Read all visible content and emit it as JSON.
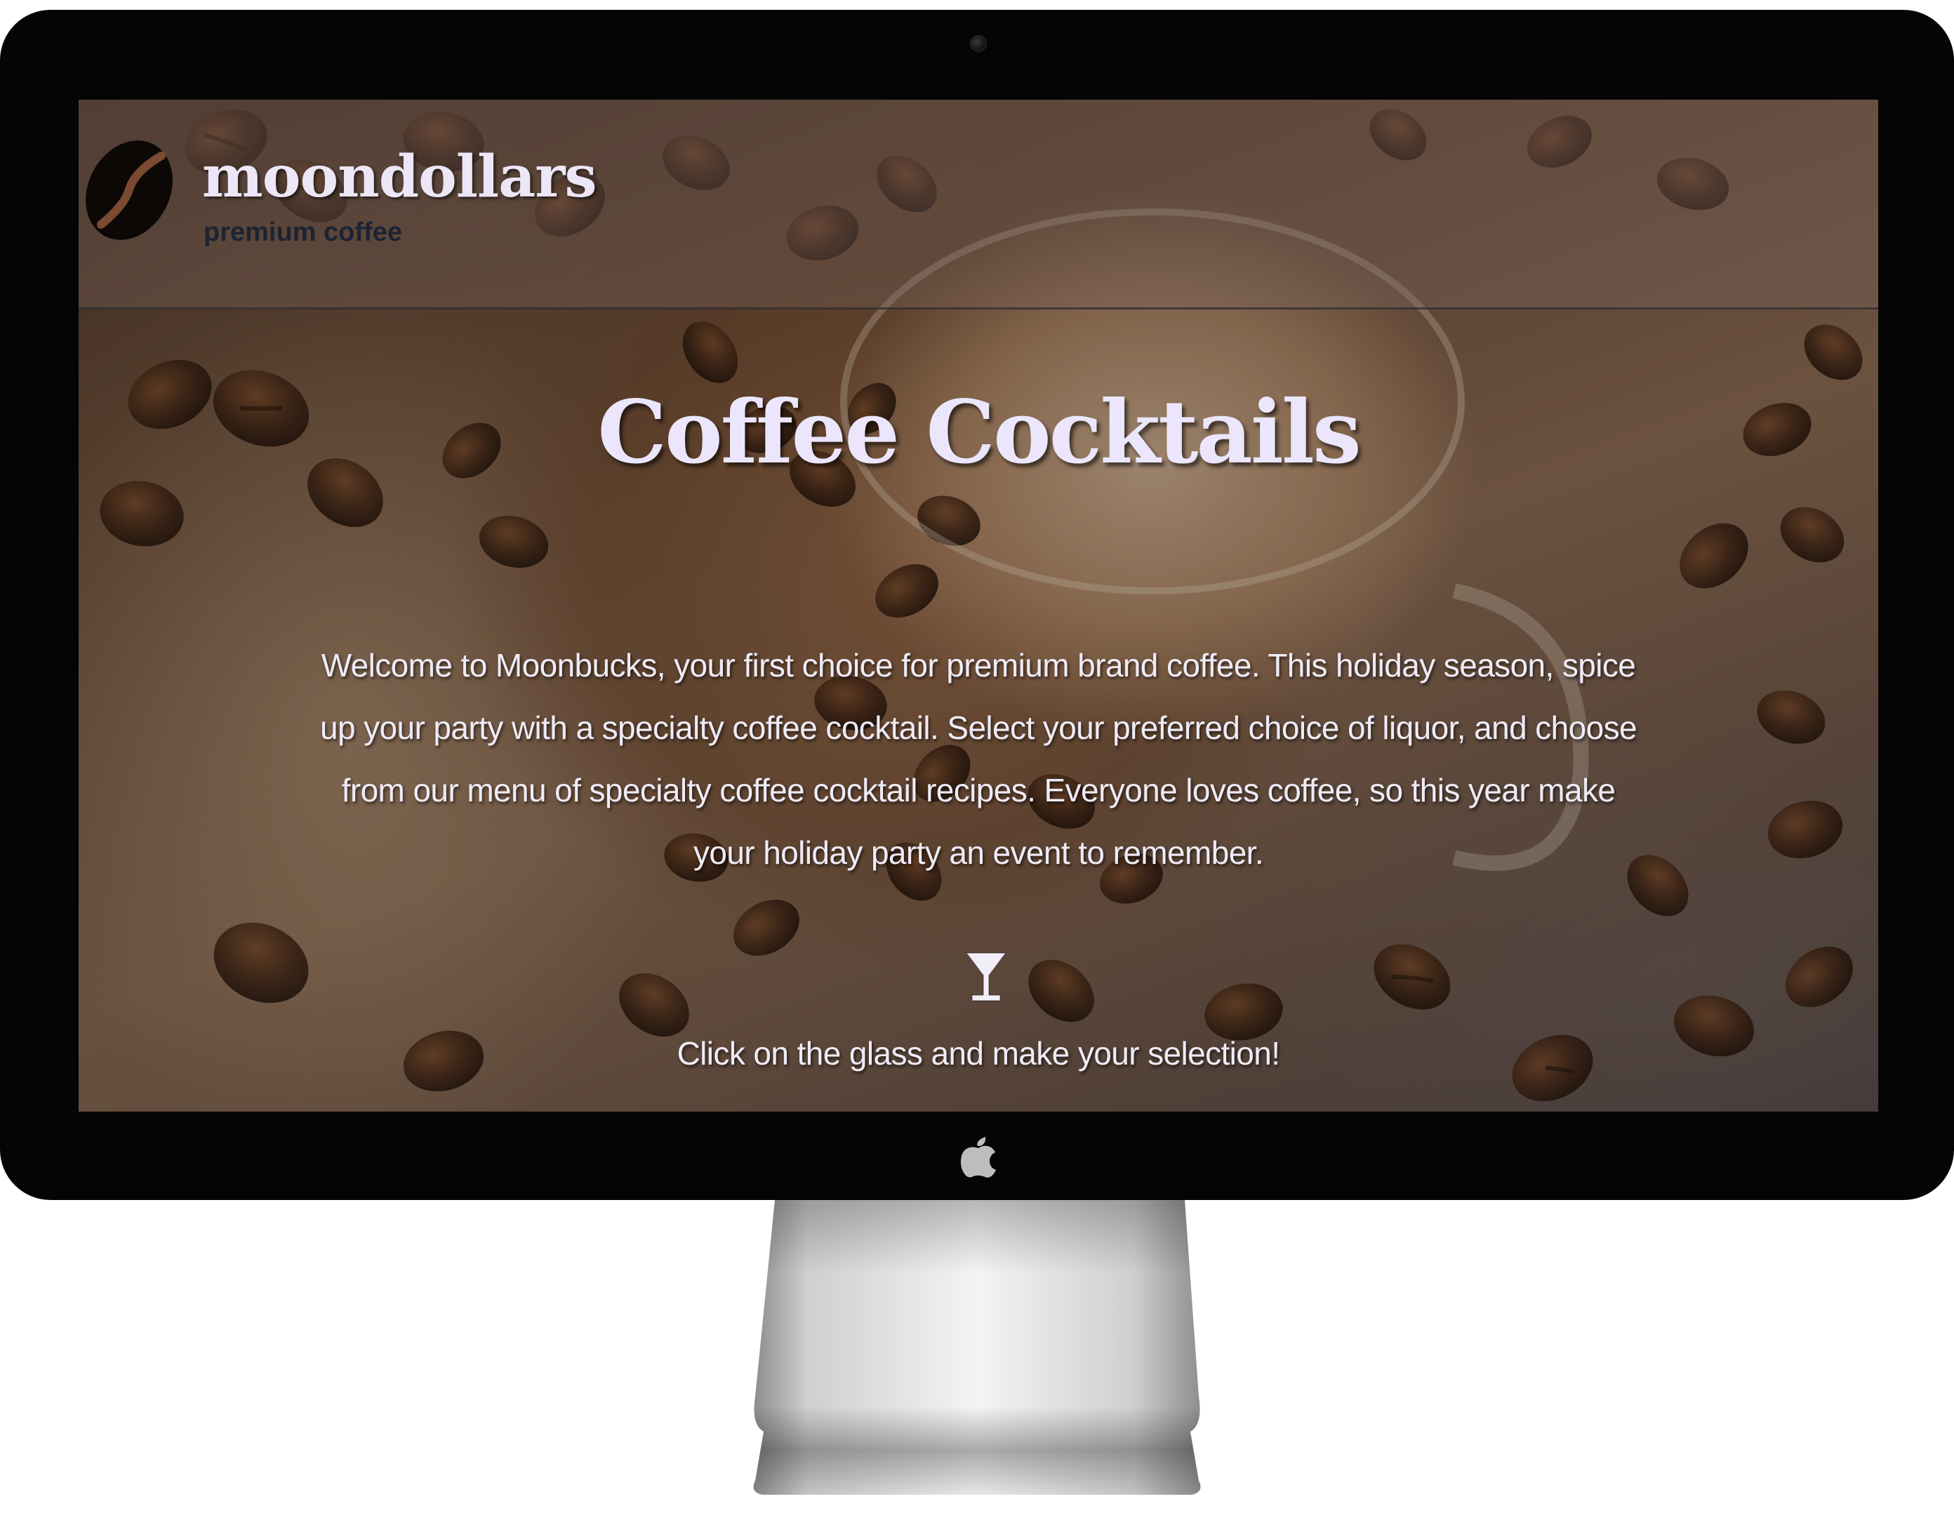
{
  "header": {
    "brand_name": "moondollars",
    "brand_tagline": "premium coffee"
  },
  "hero": {
    "title": "Coffee Cocktails",
    "description": "Welcome to Moonbucks, your first choice for premium brand coffee. This holiday season, spice up your party with a specialty coffee cocktail. Select your preferred choice of liquor, and choose from our menu of specialty coffee cocktail recipes. Everyone loves coffee, so this year make your holiday party an event to remember.",
    "glass_icon": "cocktail-glass-icon",
    "call_to_action": "Click on the glass and make your selection!"
  },
  "colors": {
    "title_text": "#ebe6fb",
    "body_text": "#efebf6",
    "tagline_text": "#1d2333",
    "bezel": "#050505"
  }
}
